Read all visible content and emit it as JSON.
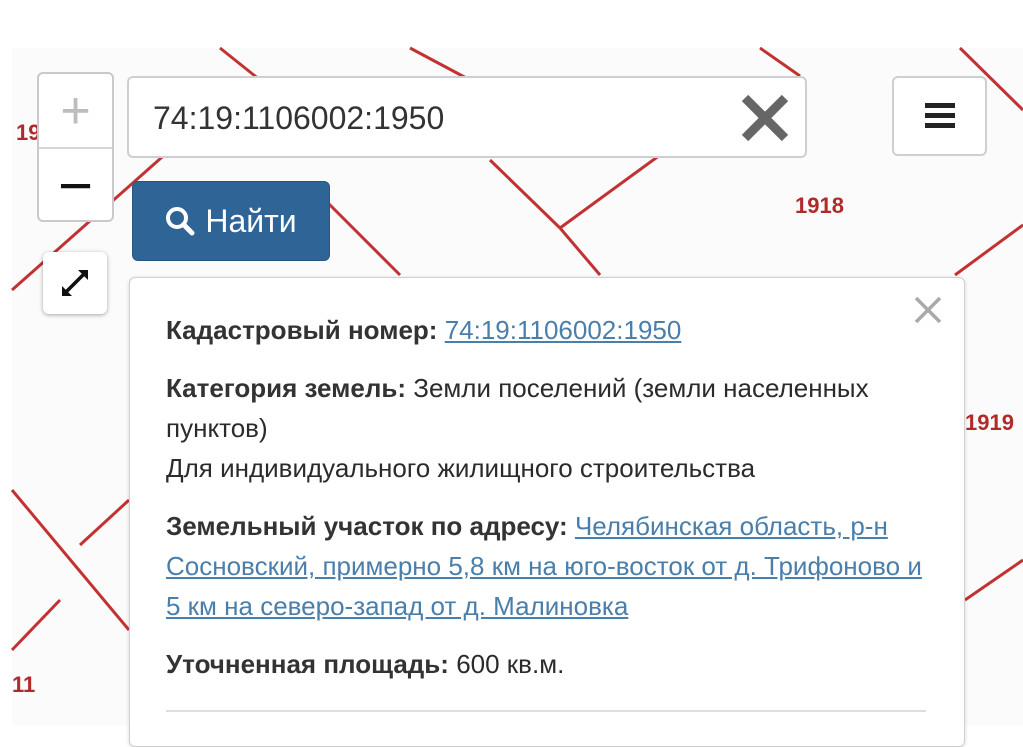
{
  "map": {
    "plot_labels": [
      "1918",
      "1919",
      "19",
      "11"
    ],
    "line_color": "#c23232"
  },
  "controls": {
    "zoom_in": "+",
    "zoom_out": "−",
    "fullscreen_icon": "expand-arrows-icon"
  },
  "search": {
    "value": "74:19:1106002:1950",
    "find_label": "Найти",
    "button_color": "#2f6496"
  },
  "popup": {
    "cadastral_label": "Кадастровый номер:",
    "cadastral_value": "74:19:1106002:1950",
    "category_label": "Категория земель:",
    "category_value": "Земли поселений (земли населенных пунктов)",
    "usage": "Для индивидуального жилищного строительства",
    "address_label": "Земельный участок по адресу:",
    "address_value": "Челябинская область, р-н Сосновский, примерно 5,8 км на юго-восток от д. Трифоново и 5 км на северо-запад от д. Малиновка",
    "area_label": "Уточненная площадь:",
    "area_value": "600 кв.м."
  }
}
